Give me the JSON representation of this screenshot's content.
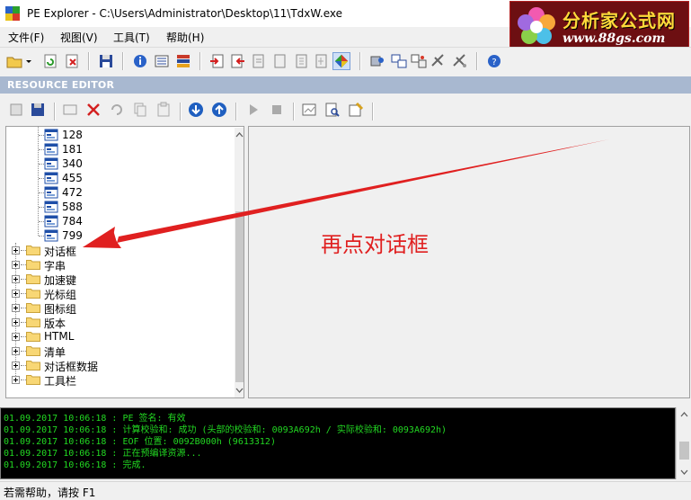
{
  "window": {
    "title": "PE Explorer - C:\\Users\\Administrator\\Desktop\\11\\TdxW.exe"
  },
  "watermark": {
    "name": "分析家公式网",
    "url": "www.88gs.com"
  },
  "menu": [
    {
      "label": "文件(F)"
    },
    {
      "label": "视图(V)"
    },
    {
      "label": "工具(T)"
    },
    {
      "label": "帮助(H)"
    }
  ],
  "resource_editor": {
    "header": "RESOURCE EDITOR"
  },
  "tree": {
    "leaves": [
      "128",
      "181",
      "340",
      "455",
      "472",
      "588",
      "784",
      "799"
    ],
    "folders": [
      "对话框",
      "字串",
      "加速键",
      "光标组",
      "图标组",
      "版本",
      "HTML",
      "清单",
      "对话框数据",
      "工具栏"
    ]
  },
  "annotation": {
    "text": "再点对话框",
    "color": "#e02020"
  },
  "log": [
    "01.09.2017 10:06:18 : PE 签名: 有效",
    "01.09.2017 10:06:18 : 计算校验和: 成功 (头部的校验和: 0093A692h / 实际校验和: 0093A692h)",
    "01.09.2017 10:06:18 : EOF 位置: 0092B000h  (9613312)",
    "01.09.2017 10:06:18 : 正在预编译资源...",
    "01.09.2017 10:06:18 : 完成."
  ],
  "status": {
    "text": "若需帮助，请按 F1"
  },
  "colors": {
    "log_text": "#22d822",
    "header_bg": "#a8b8d0",
    "logo_bg": "#6d0f12"
  }
}
